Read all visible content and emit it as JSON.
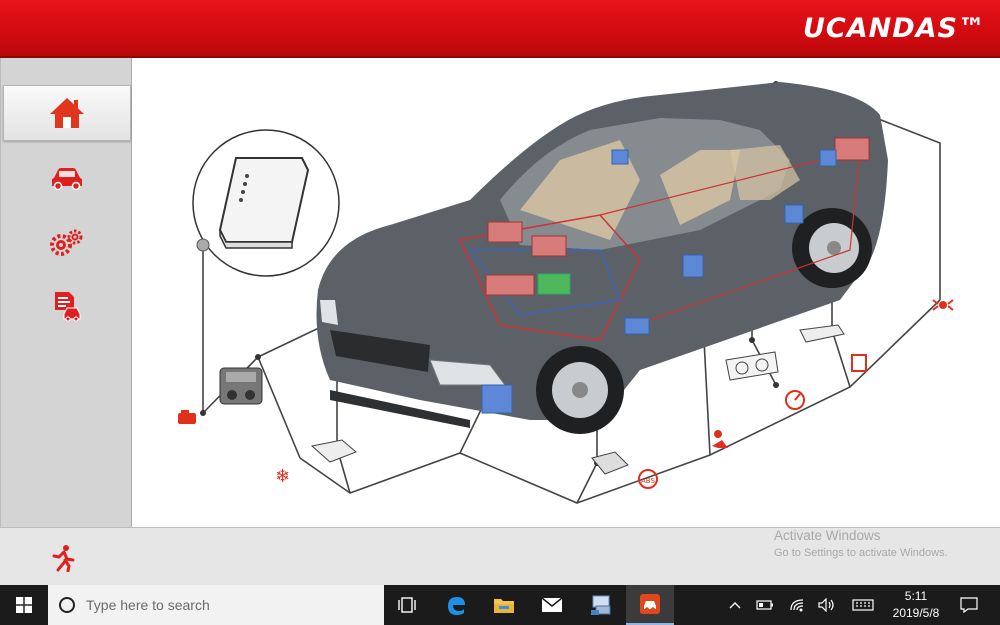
{
  "header": {
    "brand": "UCANDAS™"
  },
  "sidebar": {
    "items": [
      {
        "name": "home",
        "icon": "home-icon",
        "active": true
      },
      {
        "name": "vehicle",
        "icon": "car-icon",
        "active": false
      },
      {
        "name": "special-functions",
        "icon": "gears-icon",
        "active": false
      },
      {
        "name": "reports",
        "icon": "report-icon",
        "active": false
      }
    ]
  },
  "bottom": {
    "exit_icon": "running-man-icon"
  },
  "watermark": {
    "title": "Activate Windows",
    "subtitle": "Go to Settings to activate Windows."
  },
  "taskbar": {
    "search_placeholder": "Type here to search",
    "time": "5:11",
    "date": "2019/5/8"
  },
  "colors": {
    "brand_red": "#d10a10",
    "sidebar": "#d4d4d4",
    "icon_red": "#e02020"
  }
}
